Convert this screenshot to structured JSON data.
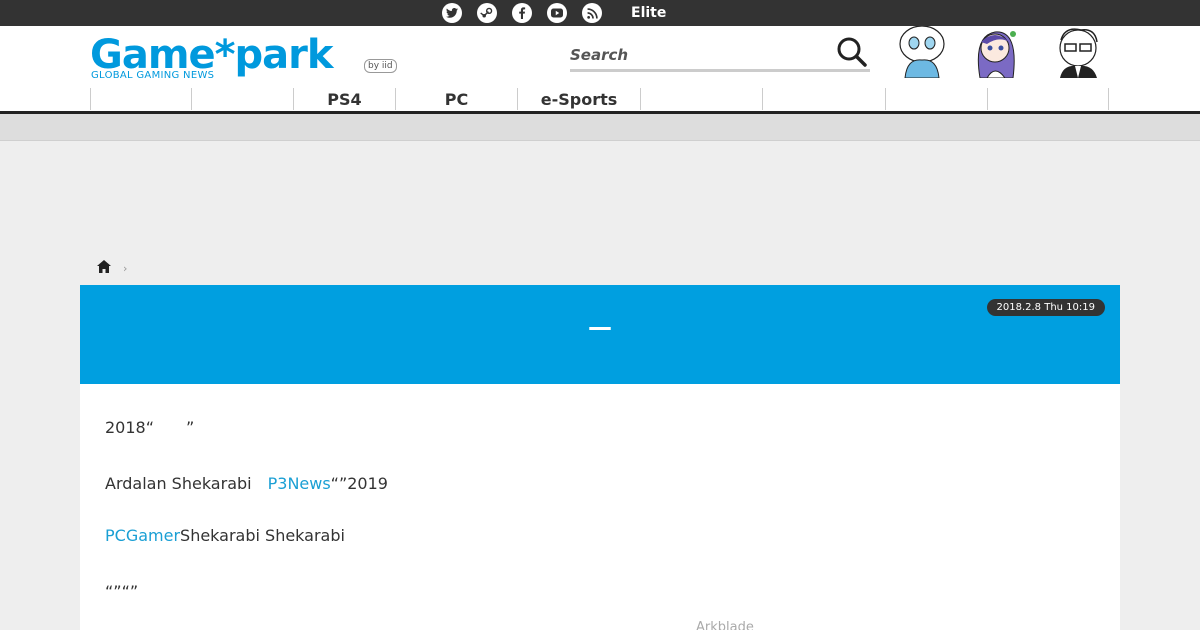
{
  "topbar": {
    "lang_label": "",
    "social": [
      {
        "icon": "twitter-icon"
      },
      {
        "icon": "steam-icon"
      },
      {
        "icon": "facebook-icon"
      },
      {
        "icon": "youtube-icon"
      },
      {
        "icon": "rss-icon"
      }
    ],
    "elite_label": "Elite",
    "glyph_left": "",
    "glyph_right": ""
  },
  "logo": {
    "brand": "Game*park",
    "tagline": "GLOBAL GAMING NEWS",
    "byline": "by iid"
  },
  "search": {
    "placeholder": "Search"
  },
  "nav": {
    "items": [
      {
        "label": "",
        "active": true
      },
      {
        "label": ""
      },
      {
        "label": "PS4"
      },
      {
        "label": "PC"
      },
      {
        "label": "e-Sports"
      },
      {
        "label": ""
      },
      {
        "label": ""
      },
      {
        "label": ""
      },
      {
        "label": ""
      },
      {
        "label": ""
      }
    ]
  },
  "breadcrumb": {
    "separator": "›"
  },
  "article": {
    "date": "2018.2.8 Thu 10:19",
    "title": "—",
    "p1": "2018“　　”",
    "p2_a": "Ardalan Shekarabi　",
    "p2_link": "P3News",
    "p2_b": "“”2019",
    "p3_link": "PCGamer",
    "p3_b": "Shekarabi Shekarabi",
    "p4": "“”“”",
    "caption": "Arkblade"
  },
  "colors": {
    "accent": "#009fe0",
    "topbar": "#333333",
    "link": "#1a9fd4"
  }
}
